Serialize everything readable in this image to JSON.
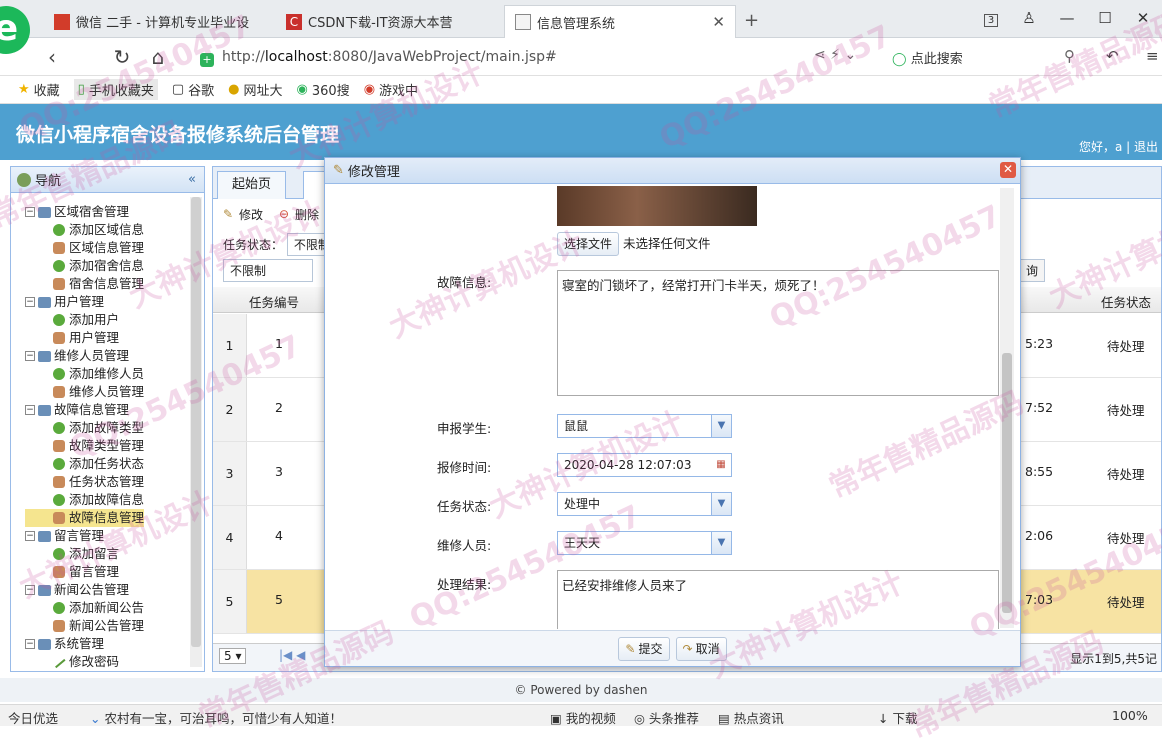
{
  "browser": {
    "tabs": [
      {
        "label": "微信 二手 - 计算机专业毕业设",
        "active": false
      },
      {
        "label": "CSDN下载-IT资源大本营",
        "active": false
      },
      {
        "label": "信息管理系统",
        "active": true
      }
    ],
    "tab_count": "3",
    "url_prefix": "http://",
    "url_host": "localhost",
    "url_rest": ":8080/JavaWebProject/main.jsp#",
    "search_placeholder": "点此搜索",
    "bookmarks": [
      "收藏",
      "手机收藏夹",
      "谷歌",
      "网址大",
      "360搜",
      "游戏中"
    ]
  },
  "app": {
    "title": "微信小程序宿舍设备报修系统后台管理",
    "user_info": "您好，a | 退出"
  },
  "nav": {
    "title": "导航",
    "groups": [
      {
        "label": "区域宿舍管理",
        "items": [
          "添加区域信息",
          "区域信息管理",
          "添加宿舍信息",
          "宿舍信息管理"
        ]
      },
      {
        "label": "用户管理",
        "items": [
          "添加用户",
          "用户管理"
        ]
      },
      {
        "label": "维修人员管理",
        "items": [
          "添加维修人员",
          "维修人员管理"
        ]
      },
      {
        "label": "故障信息管理",
        "items": [
          "添加故障类型",
          "故障类型管理",
          "添加任务状态",
          "任务状态管理",
          "添加故障信息",
          "故障信息管理"
        ]
      },
      {
        "label": "留言管理",
        "items": [
          "添加留言",
          "留言管理"
        ]
      },
      {
        "label": "新闻公告管理",
        "items": [
          "添加新闻公告",
          "新闻公告管理"
        ]
      },
      {
        "label": "系统管理",
        "items": [
          "修改密码"
        ]
      }
    ]
  },
  "main": {
    "tab_home": "起始页",
    "toolbar": {
      "edit": "修改",
      "delete": "删除"
    },
    "filter_label": "任务状态：",
    "filter_value": "不限制",
    "filter_value2": "不限制",
    "query_label": "询",
    "col_task_no": "任务编号",
    "col_status": "任务状态",
    "rows": [
      {
        "rn": "1",
        "no": "1",
        "time": "5:23",
        "status": "待处理"
      },
      {
        "rn": "2",
        "no": "2",
        "time": "7:52",
        "status": "待处理"
      },
      {
        "rn": "3",
        "no": "3",
        "time": "8:55",
        "status": "待处理"
      },
      {
        "rn": "4",
        "no": "4",
        "time": "2:06",
        "status": "待处理"
      },
      {
        "rn": "5",
        "no": "5",
        "time": "7:03",
        "status": "待处理"
      }
    ],
    "page_size": "5",
    "pager_info": "显示1到5,共5记"
  },
  "dialog": {
    "title": "修改管理",
    "choose_file": "选择文件",
    "no_file": "未选择任何文件",
    "fault_label": "故障信息:",
    "fault_value": "寝室的门锁坏了，经常打开门卡半天，烦死了！",
    "student_label": "申报学生:",
    "student_value": "鼠鼠",
    "time_label": "报修时间:",
    "time_value": "2020-04-28 12:07:03",
    "status_label": "任务状态:",
    "status_value": "处理中",
    "repairman_label": "维修人员:",
    "repairman_value": "王天天",
    "result_label": "处理结果:",
    "result_value": "已经安排维修人员来了",
    "submit": "提交",
    "cancel": "取消"
  },
  "footer": "© Powered by dashen",
  "statusbar": {
    "left": "今日优选",
    "news": "农村有一宝，可治耳鸣，可惜少有人知道！",
    "items": [
      "我的视频",
      "头条推荐",
      "热点资讯",
      "下载",
      "100%"
    ]
  },
  "watermarks": [
    "QQ:254540457",
    "大神计算机设计",
    "常年售精品源码"
  ],
  "colors": {
    "header": "#4ea0d0",
    "accent": "#99bbe8",
    "selected": "#f5e58f",
    "logo": "#1cb85a"
  }
}
